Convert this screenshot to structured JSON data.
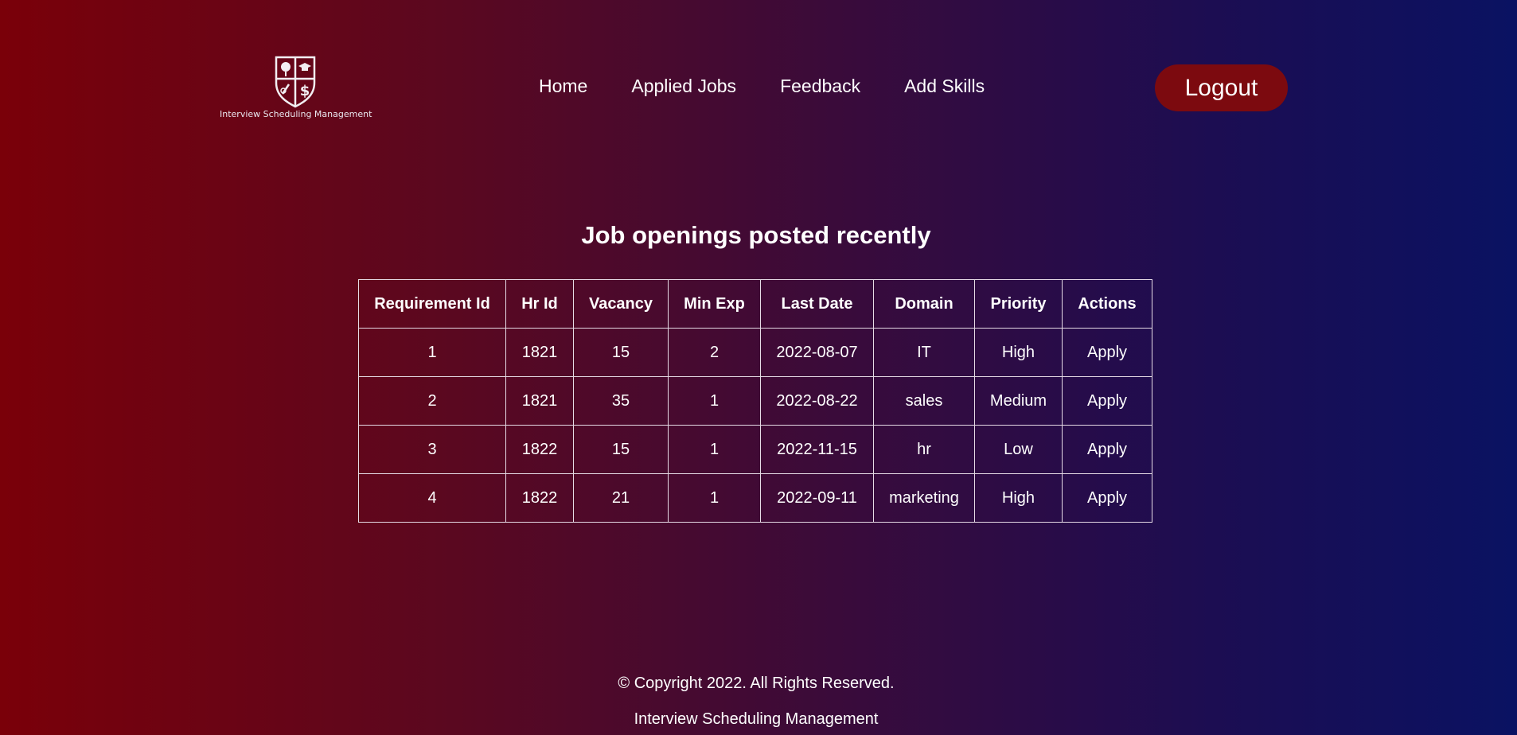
{
  "header": {
    "logo_text": "Interview Scheduling Management",
    "nav": [
      {
        "label": "Home"
      },
      {
        "label": "Applied Jobs"
      },
      {
        "label": "Feedback"
      },
      {
        "label": "Add Skills"
      }
    ],
    "logout_label": "Logout"
  },
  "main": {
    "title": "Job openings posted recently",
    "table": {
      "headers": [
        "Requirement Id",
        "Hr Id",
        "Vacancy",
        "Min Exp",
        "Last Date",
        "Domain",
        "Priority",
        "Actions"
      ],
      "rows": [
        [
          "1",
          "1821",
          "15",
          "2",
          "2022-08-07",
          "IT",
          "High",
          "Apply"
        ],
        [
          "2",
          "1821",
          "35",
          "1",
          "2022-08-22",
          "sales",
          "Medium",
          "Apply"
        ],
        [
          "3",
          "1822",
          "15",
          "1",
          "2022-11-15",
          "hr",
          "Low",
          "Apply"
        ],
        [
          "4",
          "1822",
          "21",
          "1",
          "2022-09-11",
          "marketing",
          "High",
          "Apply"
        ]
      ]
    }
  },
  "footer": {
    "copyright": "© Copyright 2022. All Rights Reserved.",
    "name": "Interview Scheduling Management"
  },
  "colors": {
    "gradient_left": "#7a0009",
    "gradient_right": "#0a1262",
    "logout_bg": "#7c0a0f",
    "text": "#ffffff"
  },
  "icons": {
    "logo": "shield-crest-icon"
  }
}
